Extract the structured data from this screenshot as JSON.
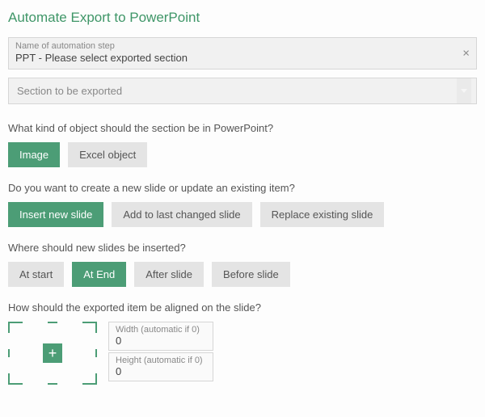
{
  "title": "Automate Export to PowerPoint",
  "name_field": {
    "label": "Name of automation step",
    "value": "PPT - Please select exported section"
  },
  "section_dropdown": {
    "placeholder": "Section to be exported"
  },
  "q1": {
    "text": "What kind of object should the section be in PowerPoint?",
    "options": {
      "image": "Image",
      "excel": "Excel object"
    }
  },
  "q2": {
    "text": "Do you want to create a new slide or update an existing item?",
    "options": {
      "insert": "Insert new slide",
      "add": "Add to last changed slide",
      "replace": "Replace existing slide"
    }
  },
  "q3": {
    "text": "Where should new slides be inserted?",
    "options": {
      "start": "At start",
      "end": "At End",
      "after": "After slide",
      "before": "Before slide"
    }
  },
  "q4": {
    "text": "How should the exported item be aligned on the slide?"
  },
  "dims": {
    "width_label": "Width (automatic if 0)",
    "width_value": "0",
    "height_label": "Height (automatic if 0)",
    "height_value": "0"
  },
  "icons": {
    "clear": "×",
    "plus": "+"
  }
}
